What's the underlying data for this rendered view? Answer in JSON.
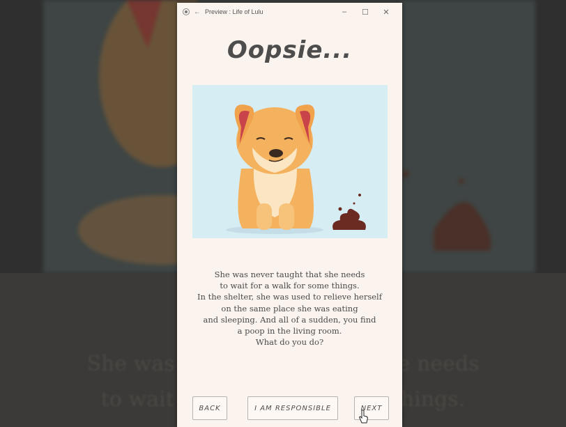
{
  "window": {
    "title": "Preview : Life of Lulu",
    "back_glyph": "←",
    "minimize_glyph": "–",
    "maximize_glyph": "☐",
    "close_glyph": "✕"
  },
  "page": {
    "heading": "Oopsie...",
    "story_lines": [
      "She was never taught that she needs",
      "to wait for a walk for some things.",
      "In the shelter, she was used to relieve herself",
      "on the same place she was eating",
      "and sleeping. And all of a sudden, you find",
      "a poop in the living room.",
      "What do you do?"
    ]
  },
  "background": {
    "line1": "She was never taught that she needs",
    "line2": "to wait for a walk for some things."
  },
  "buttons": {
    "back": "BACK",
    "responsible": "I AM RESPONSIBLE",
    "next": "NEXT"
  },
  "colors": {
    "page_bg": "#fbf3ee",
    "illustration_bg": "#d6edf4",
    "dog_fur": "#f4b25f",
    "dog_ear": "#c8434a",
    "poop": "#6b2a22"
  }
}
